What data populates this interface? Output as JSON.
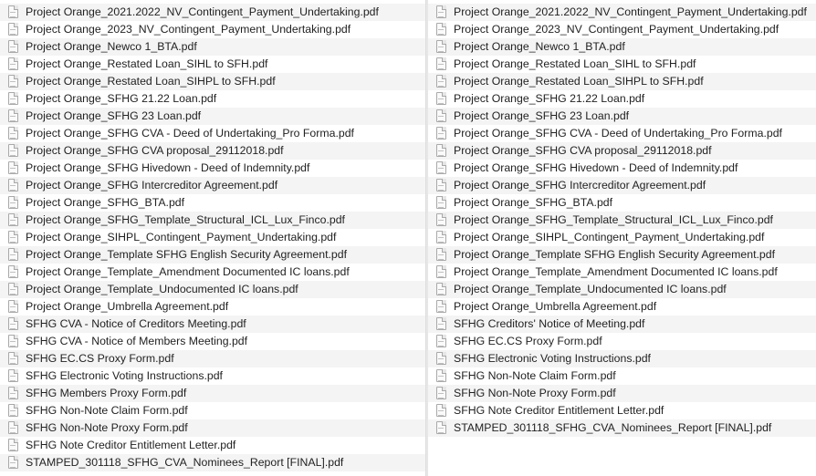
{
  "left_files": [
    "Project Orange_2021.2022_NV_Contingent_Payment_Undertaking.pdf",
    "Project Orange_2023_NV_Contingent_Payment_Undertaking.pdf",
    "Project Orange_Newco 1_BTA.pdf",
    "Project Orange_Restated Loan_SIHL to SFH.pdf",
    "Project Orange_Restated Loan_SIHPL to SFH.pdf",
    "Project Orange_SFHG 21.22 Loan.pdf",
    "Project Orange_SFHG 23 Loan.pdf",
    "Project Orange_SFHG CVA - Deed of Undertaking_Pro Forma.pdf",
    "Project Orange_SFHG CVA proposal_29112018.pdf",
    "Project Orange_SFHG Hivedown - Deed of Indemnity.pdf",
    "Project Orange_SFHG Intercreditor Agreement.pdf",
    "Project Orange_SFHG_BTA.pdf",
    "Project Orange_SFHG_Template_Structural_ICL_Lux_Finco.pdf",
    "Project Orange_SIHPL_Contingent_Payment_Undertaking.pdf",
    "Project Orange_Template SFHG English Security Agreement.pdf",
    "Project Orange_Template_Amendment Documented IC loans.pdf",
    "Project Orange_Template_Undocumented IC loans.pdf",
    "Project Orange_Umbrella Agreement.pdf",
    "SFHG CVA - Notice of Creditors Meeting.pdf",
    "SFHG CVA - Notice of Members Meeting.pdf",
    "SFHG EC.CS Proxy Form.pdf",
    "SFHG Electronic Voting Instructions.pdf",
    "SFHG Members Proxy Form.pdf",
    "SFHG Non-Note Claim Form.pdf",
    "SFHG Non-Note Proxy Form.pdf",
    "SFHG Note Creditor Entitlement Letter.pdf",
    "STAMPED_301118_SFHG_CVA_Nominees_Report [FINAL].pdf"
  ],
  "right_files": [
    "Project Orange_2021.2022_NV_Contingent_Payment_Undertaking.pdf",
    "Project Orange_2023_NV_Contingent_Payment_Undertaking.pdf",
    "Project Orange_Newco 1_BTA.pdf",
    "Project Orange_Restated Loan_SIHL to SFH.pdf",
    "Project Orange_Restated Loan_SIHPL to SFH.pdf",
    "Project Orange_SFHG 21.22 Loan.pdf",
    "Project Orange_SFHG 23 Loan.pdf",
    "Project Orange_SFHG CVA - Deed of Undertaking_Pro Forma.pdf",
    "Project Orange_SFHG CVA proposal_29112018.pdf",
    "Project Orange_SFHG Hivedown - Deed of Indemnity.pdf",
    "Project Orange_SFHG Intercreditor Agreement.pdf",
    "Project Orange_SFHG_BTA.pdf",
    "Project Orange_SFHG_Template_Structural_ICL_Lux_Finco.pdf",
    "Project Orange_SIHPL_Contingent_Payment_Undertaking.pdf",
    "Project Orange_Template SFHG English Security Agreement.pdf",
    "Project Orange_Template_Amendment Documented IC loans.pdf",
    "Project Orange_Template_Undocumented IC loans.pdf",
    "Project Orange_Umbrella Agreement.pdf",
    "SFHG Creditors' Notice of Meeting.pdf",
    "SFHG EC.CS Proxy Form.pdf",
    "SFHG Electronic Voting Instructions.pdf",
    "SFHG Non-Note Claim Form.pdf",
    "SFHG Non-Note Proxy Form.pdf",
    "SFHG Note Creditor Entitlement Letter.pdf",
    "STAMPED_301118_SFHG_CVA_Nominees_Report [FINAL].pdf"
  ],
  "icons": {
    "file": "pdf-document-icon"
  },
  "colors": {
    "row_alt": "#f4f4f4",
    "text": "#222222",
    "background": "#ffffff"
  }
}
